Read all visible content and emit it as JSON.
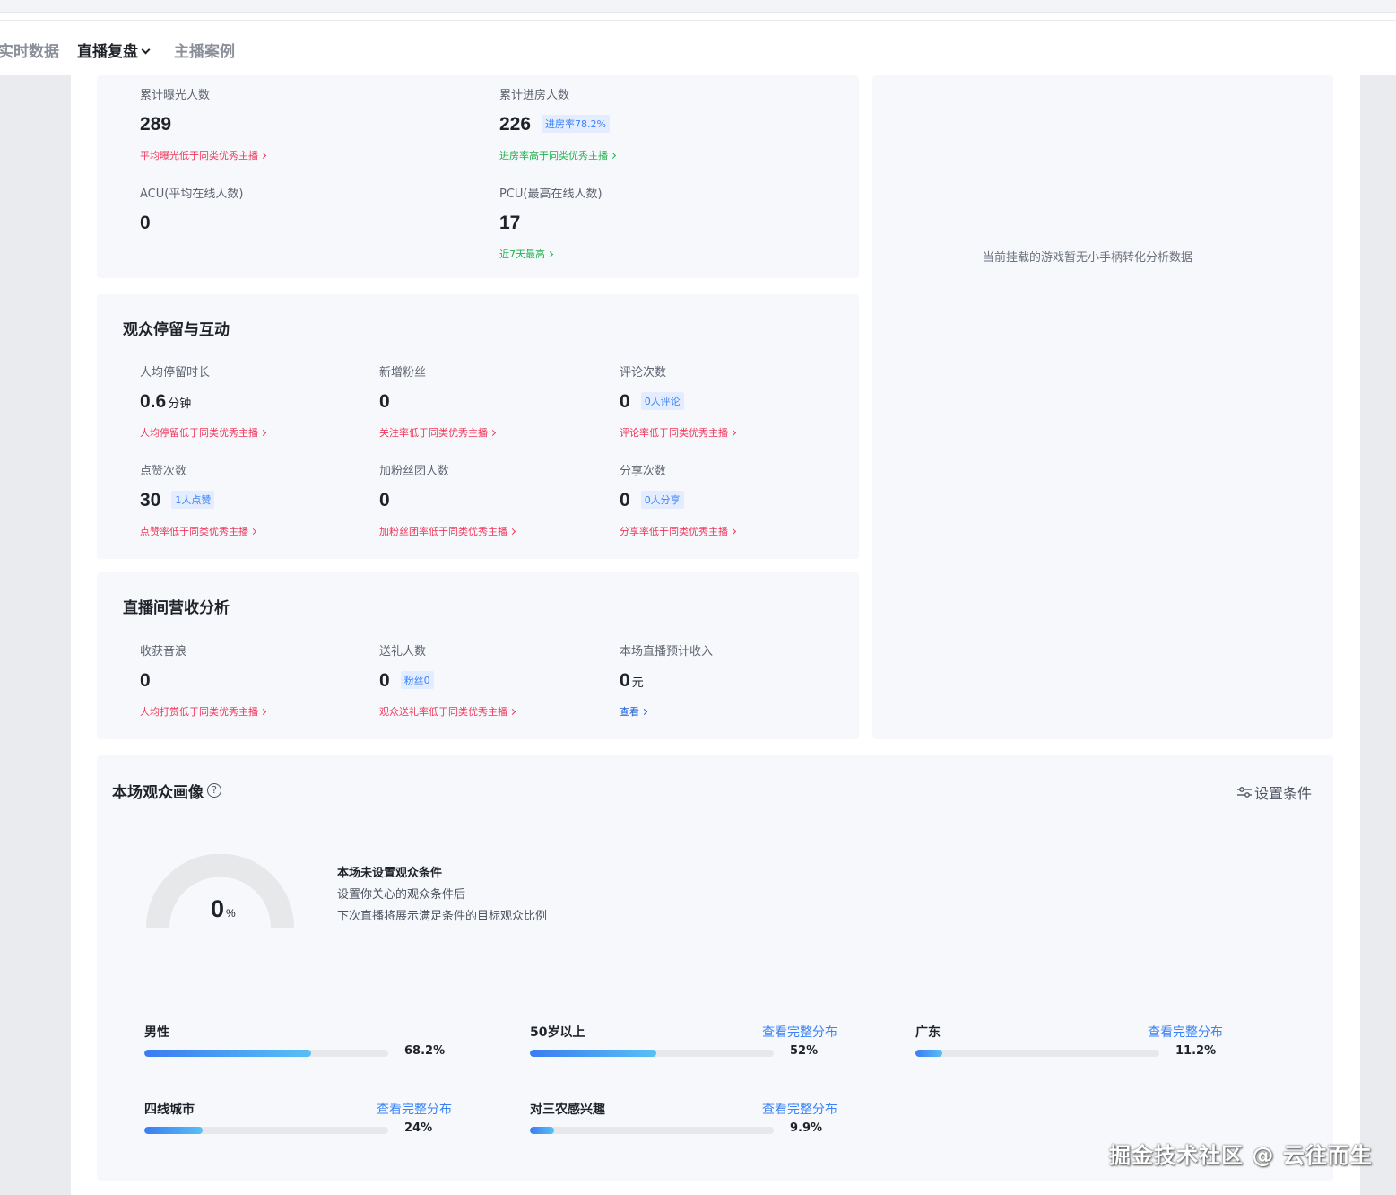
{
  "nav": {
    "items": [
      {
        "label": "实时数据"
      },
      {
        "label": "直播复盘"
      },
      {
        "label": "主播案例"
      }
    ]
  },
  "traffic": {
    "exposure": {
      "label": "累计曝光人数",
      "value": "289",
      "hint": "平均曝光低于同类优秀主播"
    },
    "enter": {
      "label": "累计进房人数",
      "value": "226",
      "tag": "进房率78.2%",
      "hint": "进房率高于同类优秀主播"
    },
    "acu": {
      "label": "ACU(平均在线人数)",
      "value": "0"
    },
    "pcu": {
      "label": "PCU(最高在线人数)",
      "value": "17",
      "hint": "近7天最高"
    }
  },
  "side_panel": {
    "empty_text": "当前挂载的游戏暂无小手柄转化分析数据"
  },
  "engagement": {
    "title": "观众停留与互动",
    "stay": {
      "label": "人均停留时长",
      "value": "0.6",
      "unit": "分钟",
      "hint": "人均停留低于同类优秀主播"
    },
    "new_fans": {
      "label": "新增粉丝",
      "value": "0",
      "hint": "关注率低于同类优秀主播"
    },
    "comments": {
      "label": "评论次数",
      "value": "0",
      "tag": "0人评论",
      "hint": "评论率低于同类优秀主播"
    },
    "likes": {
      "label": "点赞次数",
      "value": "30",
      "tag": "1人点赞",
      "hint": "点赞率低于同类优秀主播"
    },
    "fan_club": {
      "label": "加粉丝团人数",
      "value": "0",
      "hint": "加粉丝团率低于同类优秀主播"
    },
    "shares": {
      "label": "分享次数",
      "value": "0",
      "tag": "0人分享",
      "hint": "分享率低于同类优秀主播"
    }
  },
  "revenue": {
    "title": "直播间营收分析",
    "sound_waves": {
      "label": "收获音浪",
      "value": "0",
      "hint": "人均打赏低于同类优秀主播"
    },
    "gifters": {
      "label": "送礼人数",
      "value": "0",
      "tag": "粉丝0",
      "hint": "观众送礼率低于同类优秀主播"
    },
    "income": {
      "label": "本场直播预计收入",
      "value": "0",
      "unit": "元",
      "hint": "查看"
    }
  },
  "audience": {
    "title": "本场观众画像",
    "help": "?",
    "settings_label": "设置条件",
    "gauge": {
      "value": "0",
      "unit": "%",
      "percent": 0
    },
    "tip": {
      "title": "本场未设置观众条件",
      "line1": "设置你关心的观众条件后",
      "line2": "下次直播将展示满足条件的目标观众比例"
    },
    "bars": [
      {
        "name": "男性",
        "link": "",
        "pct_text": "68.2%",
        "pct": 68.2
      },
      {
        "name": "50岁以上",
        "link": "查看完整分布",
        "pct_text": "52%",
        "pct": 52
      },
      {
        "name": "广东",
        "link": "查看完整分布",
        "pct_text": "11.2%",
        "pct": 11.2
      },
      {
        "name": "四线城市",
        "link": "查看完整分布",
        "pct_text": "24%",
        "pct": 24
      },
      {
        "name": "对三农感兴趣",
        "link": "查看完整分布",
        "pct_text": "9.9%",
        "pct": 9.9
      }
    ]
  },
  "watermark": "掘金技术社区 @ 云往而生",
  "colors": {
    "accent": "#3b82f6",
    "danger": "#f0375a",
    "success": "#1fb24d",
    "card_bg": "#f6f8fb"
  }
}
